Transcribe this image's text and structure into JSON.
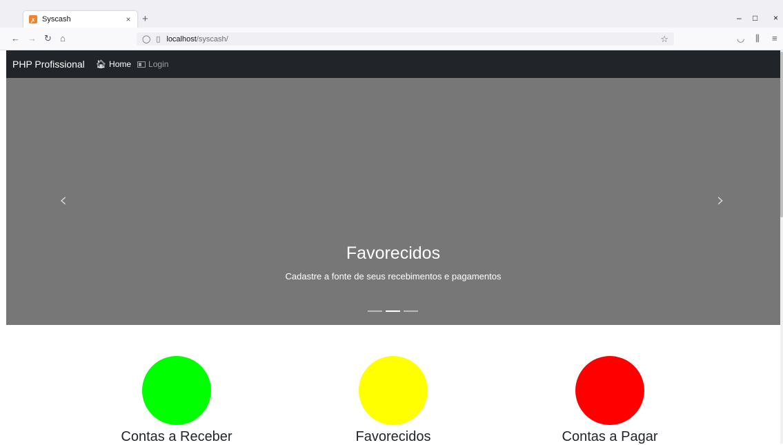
{
  "browser": {
    "tab_title": "Syscash",
    "tab_close": "×",
    "new_tab": "+",
    "url_host": "localhost",
    "url_path": "/syscash/",
    "win_minimize": "–",
    "win_maximize": "□",
    "win_close": "×"
  },
  "nav": {
    "brand": "PHP Profissional",
    "items": [
      {
        "label": "Home",
        "icon": "home-icon"
      },
      {
        "label": "Login",
        "icon": "id-card-icon"
      }
    ]
  },
  "carousel": {
    "title": "Favorecidos",
    "subtitle": "Cadastre a fonte de seus recebimentos e pagamentos",
    "slides": 3,
    "active_index": 1,
    "prev_glyph": "‹",
    "next_glyph": "›"
  },
  "features": [
    {
      "label": "Contas a Receber",
      "color": "#00ff00"
    },
    {
      "label": "Favorecidos",
      "color": "#ffff00"
    },
    {
      "label": "Contas a Pagar",
      "color": "#ff0000"
    }
  ],
  "colors": {
    "navbar": "#212529",
    "carousel_bg": "#777777"
  }
}
